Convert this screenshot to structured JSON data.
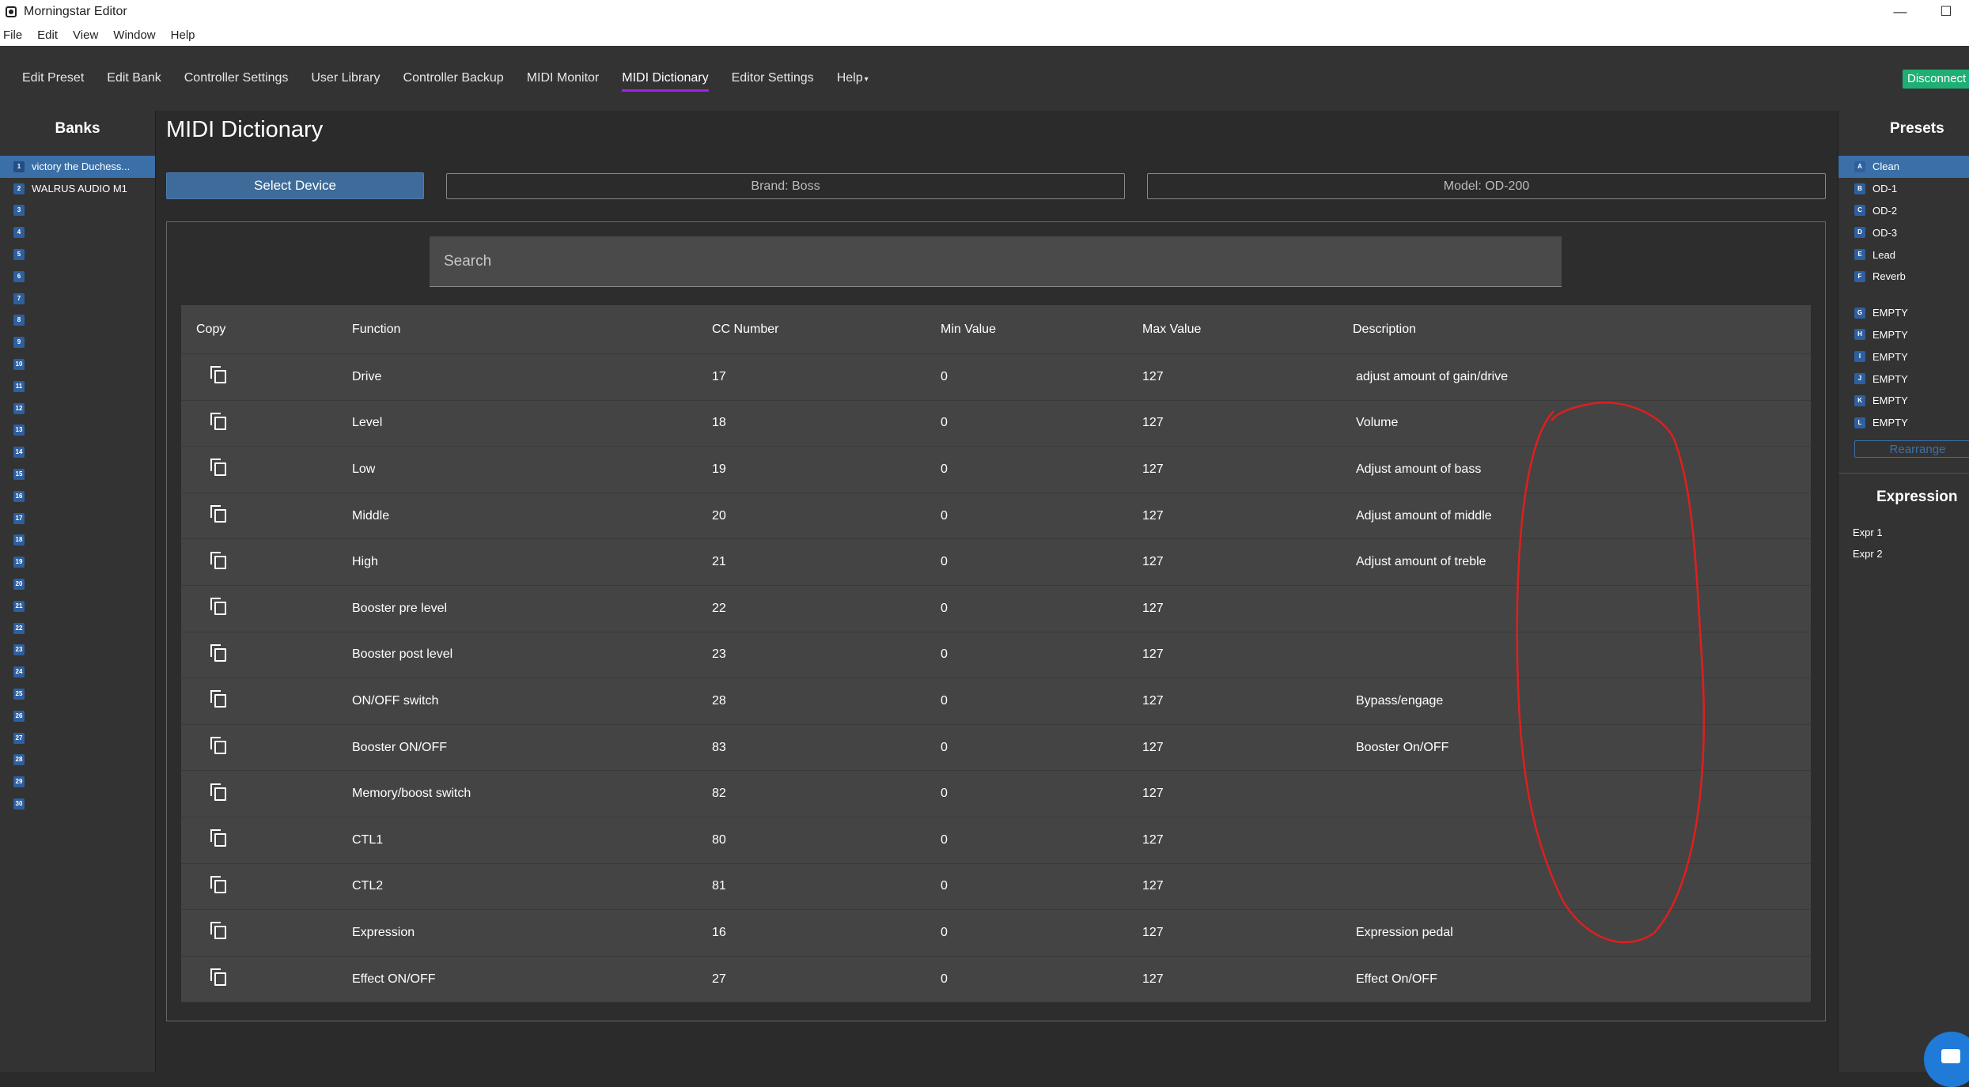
{
  "window": {
    "title": "Morningstar Editor",
    "minimize": "—",
    "maximize": "☐"
  },
  "menu": [
    "File",
    "Edit",
    "View",
    "Window",
    "Help"
  ],
  "nav": {
    "items": [
      "Edit Preset",
      "Edit Bank",
      "Controller Settings",
      "User Library",
      "Controller Backup",
      "MIDI Monitor",
      "MIDI Dictionary",
      "Editor Settings",
      "Help"
    ],
    "active": "MIDI Dictionary",
    "disconnect": "Disconnect",
    "accent_color": "#a020f0"
  },
  "banks": {
    "title": "Banks",
    "items": [
      {
        "num": "1",
        "label": "victory the Duchess..."
      },
      {
        "num": "2",
        "label": "WALRUS AUDIO M1"
      },
      {
        "num": "3",
        "label": ""
      },
      {
        "num": "4",
        "label": ""
      },
      {
        "num": "5",
        "label": ""
      },
      {
        "num": "6",
        "label": ""
      },
      {
        "num": "7",
        "label": ""
      },
      {
        "num": "8",
        "label": ""
      },
      {
        "num": "9",
        "label": ""
      },
      {
        "num": "10",
        "label": ""
      },
      {
        "num": "11",
        "label": ""
      },
      {
        "num": "12",
        "label": ""
      },
      {
        "num": "13",
        "label": ""
      },
      {
        "num": "14",
        "label": ""
      },
      {
        "num": "15",
        "label": ""
      },
      {
        "num": "16",
        "label": ""
      },
      {
        "num": "17",
        "label": ""
      },
      {
        "num": "18",
        "label": ""
      },
      {
        "num": "19",
        "label": ""
      },
      {
        "num": "20",
        "label": ""
      },
      {
        "num": "21",
        "label": ""
      },
      {
        "num": "22",
        "label": ""
      },
      {
        "num": "23",
        "label": ""
      },
      {
        "num": "24",
        "label": ""
      },
      {
        "num": "25",
        "label": ""
      },
      {
        "num": "26",
        "label": ""
      },
      {
        "num": "27",
        "label": ""
      },
      {
        "num": "28",
        "label": ""
      },
      {
        "num": "29",
        "label": ""
      },
      {
        "num": "30",
        "label": ""
      }
    ]
  },
  "main": {
    "title": "MIDI Dictionary",
    "select_device": "Select Device",
    "brand": "Brand: Boss",
    "model": "Model: OD-200",
    "search_placeholder": "Search",
    "columns": [
      "Copy",
      "Function",
      "CC Number",
      "Min Value",
      "Max Value",
      "Description"
    ],
    "rows": [
      {
        "function": "Drive",
        "cc": "17",
        "min": "0",
        "max": "127",
        "desc": "adjust amount of gain/drive"
      },
      {
        "function": "Level",
        "cc": "18",
        "min": "0",
        "max": "127",
        "desc": "Volume"
      },
      {
        "function": "Low",
        "cc": "19",
        "min": "0",
        "max": "127",
        "desc": "Adjust amount of bass"
      },
      {
        "function": "Middle",
        "cc": "20",
        "min": "0",
        "max": "127",
        "desc": "Adjust amount of middle"
      },
      {
        "function": "High",
        "cc": "21",
        "min": "0",
        "max": "127",
        "desc": "Adjust amount of treble"
      },
      {
        "function": "Booster pre level",
        "cc": "22",
        "min": "0",
        "max": "127",
        "desc": ""
      },
      {
        "function": "Booster post level",
        "cc": "23",
        "min": "0",
        "max": "127",
        "desc": ""
      },
      {
        "function": "ON/OFF switch",
        "cc": "28",
        "min": "0",
        "max": "127",
        "desc": "Bypass/engage"
      },
      {
        "function": "Booster ON/OFF",
        "cc": "83",
        "min": "0",
        "max": "127",
        "desc": "Booster On/OFF"
      },
      {
        "function": "Memory/boost switch",
        "cc": "82",
        "min": "0",
        "max": "127",
        "desc": ""
      },
      {
        "function": "CTL1",
        "cc": "80",
        "min": "0",
        "max": "127",
        "desc": ""
      },
      {
        "function": "CTL2",
        "cc": "81",
        "min": "0",
        "max": "127",
        "desc": ""
      },
      {
        "function": "Expression",
        "cc": "16",
        "min": "0",
        "max": "127",
        "desc": "Expression pedal"
      },
      {
        "function": "Effect ON/OFF",
        "cc": "27",
        "min": "0",
        "max": "127",
        "desc": "Effect On/OFF"
      }
    ]
  },
  "presets": {
    "title": "Presets",
    "items": [
      {
        "letter": "A",
        "label": "Clean"
      },
      {
        "letter": "B",
        "label": "OD-1"
      },
      {
        "letter": "C",
        "label": "OD-2"
      },
      {
        "letter": "D",
        "label": "OD-3"
      },
      {
        "letter": "E",
        "label": "Lead"
      },
      {
        "letter": "F",
        "label": "Reverb"
      },
      {
        "letter": "G",
        "label": "EMPTY"
      },
      {
        "letter": "H",
        "label": "EMPTY"
      },
      {
        "letter": "I",
        "label": "EMPTY"
      },
      {
        "letter": "J",
        "label": "EMPTY"
      },
      {
        "letter": "K",
        "label": "EMPTY"
      },
      {
        "letter": "L",
        "label": "EMPTY"
      }
    ],
    "rearrange": "Rearrange"
  },
  "expression": {
    "title": "Expression",
    "items": [
      "Expr 1",
      "Expr 2"
    ]
  },
  "annotation_color": "#e01e1e"
}
